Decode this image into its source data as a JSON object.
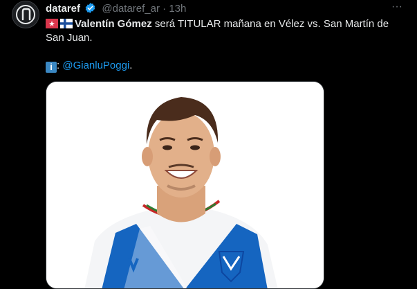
{
  "tweet": {
    "author_name": "dataref",
    "handle": "@dataref_ar",
    "separator": "·",
    "time": "13h",
    "more_label": "···",
    "verified_icon": "verified-badge-icon",
    "avatar_icon": "dataref-logo",
    "text_player": "Valentín Gómez",
    "text_rest": " será TITULAR mañana en Vélez vs. San Martín de San Juan.",
    "info_glyph": "i",
    "info_colon": ":",
    "mention": "@GianluPoggi",
    "period": ".",
    "flags": [
      "velez-flag-icon",
      "finland-flag-icon"
    ]
  },
  "media": {
    "alt": "Player photo in Vélez Sarsfield jersey",
    "brand_color": "#1565c0"
  }
}
